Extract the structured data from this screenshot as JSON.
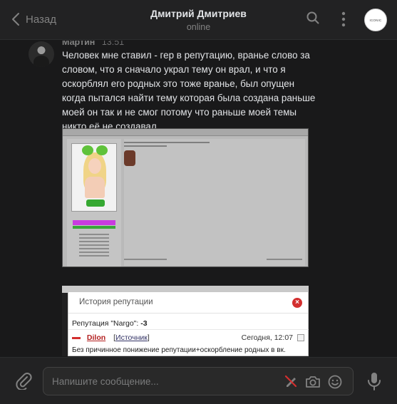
{
  "header": {
    "back_label": "Назад",
    "title": "Дмитрий Дмитриев",
    "status": "online",
    "avatar_text": "ICONIC"
  },
  "message": {
    "author": "Мартин",
    "time": "13:51",
    "text": "Человек мне ставил - гер в репутацию, вранье слово за словом, что я сначало украл тему он врал, и что я оскорблял его родных это тоже вранье, был опущен когда пытался найти тему которая была создана раньше моей он так и не смог потому что раньше моей темы никто её не создавал"
  },
  "reputation_window": {
    "title": "История репутации",
    "rep_label": "Репутация \"Nargo\":",
    "rep_value": "-3",
    "entry_user": "Dilon",
    "entry_source_open": "[",
    "entry_source": "Источник",
    "entry_source_close": "]",
    "entry_date": "Сегодня, 12:07",
    "entry_reason": "Без причинное понижение репутации+оскорбление родных в вк."
  },
  "composer": {
    "placeholder": "Напишите сообщение..."
  },
  "icons": {
    "back": "chevron-left-icon",
    "search": "search-icon",
    "more": "more-vertical-icon",
    "attach": "paperclip-icon",
    "no_keyboard": "pen-crossed-icon",
    "camera": "camera-icon",
    "emoji": "emoji-icon",
    "mic": "microphone-icon"
  },
  "colors": {
    "background": "#19191a",
    "panel": "#222223",
    "text": "#e1e3e6",
    "muted": "#828282",
    "danger": "#d32f2f"
  }
}
